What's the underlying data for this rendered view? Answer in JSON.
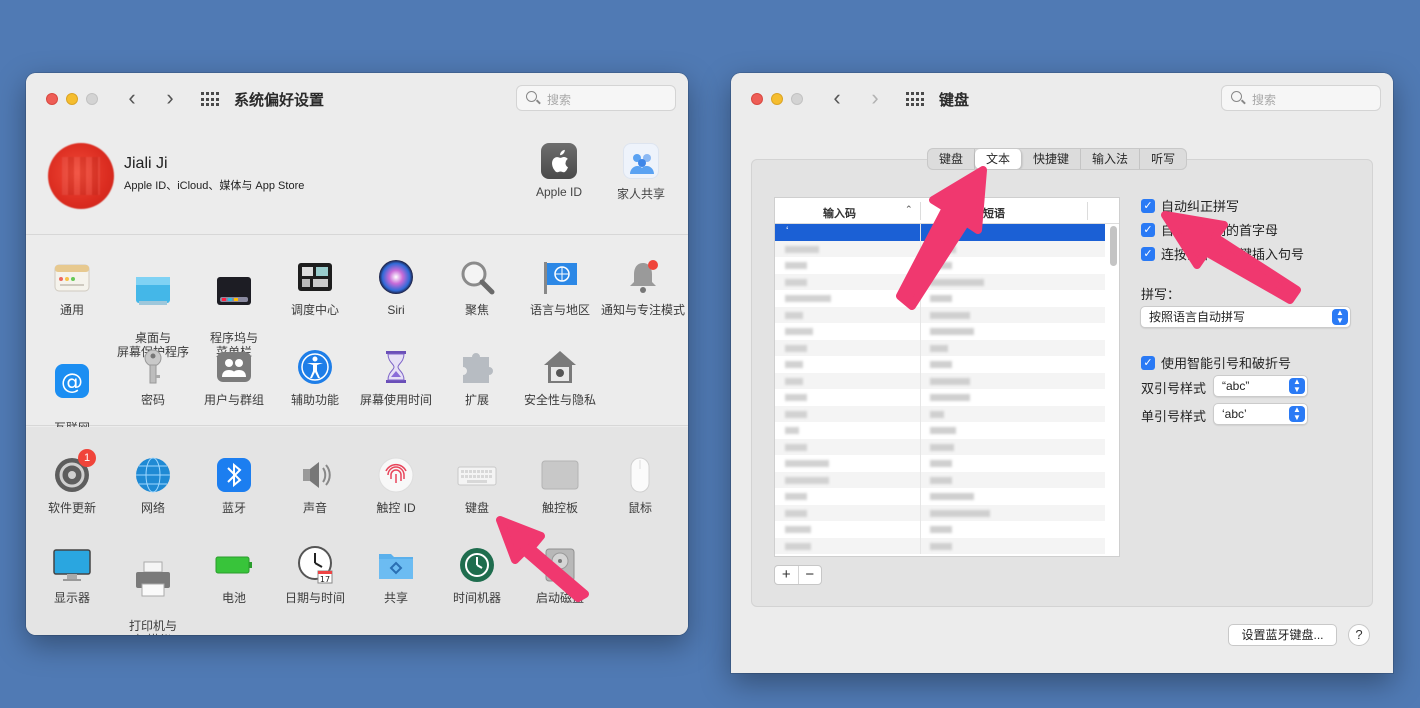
{
  "left_window": {
    "title": "系统偏好设置",
    "search_placeholder": "搜索",
    "profile": {
      "name": "Jiali Ji",
      "subtitle": "Apple ID、iCloud、媒体与 App Store",
      "apple_id_label": "Apple ID",
      "family_label": "家人共享"
    },
    "group2": [
      {
        "label": "通用",
        "icon": "general-icon"
      },
      {
        "label": "桌面与\n屏幕保护程序",
        "icon": "desktop-icon"
      },
      {
        "label": "程序坞与\n菜单栏",
        "icon": "dock-icon"
      },
      {
        "label": "调度中心",
        "icon": "mission-control-icon"
      },
      {
        "label": "Siri",
        "icon": "siri-icon"
      },
      {
        "label": "聚焦",
        "icon": "spotlight-icon"
      },
      {
        "label": "语言与地区",
        "icon": "language-icon"
      },
      {
        "label": "通知与专注模式",
        "icon": "notifications-icon"
      },
      {
        "label": "互联网\n帐户",
        "icon": "internet-accounts-icon"
      },
      {
        "label": "密码",
        "icon": "passwords-icon"
      },
      {
        "label": "用户与群组",
        "icon": "users-icon"
      },
      {
        "label": "辅助功能",
        "icon": "accessibility-icon"
      },
      {
        "label": "屏幕使用时间",
        "icon": "screen-time-icon"
      },
      {
        "label": "扩展",
        "icon": "extensions-icon"
      },
      {
        "label": "安全性与隐私",
        "icon": "security-icon"
      }
    ],
    "group3": [
      {
        "label": "软件更新",
        "icon": "software-update-icon",
        "badge": "1"
      },
      {
        "label": "网络",
        "icon": "network-icon"
      },
      {
        "label": "蓝牙",
        "icon": "bluetooth-icon"
      },
      {
        "label": "声音",
        "icon": "sound-icon"
      },
      {
        "label": "触控 ID",
        "icon": "touch-id-icon"
      },
      {
        "label": "键盘",
        "icon": "keyboard-icon"
      },
      {
        "label": "触控板",
        "icon": "trackpad-icon"
      },
      {
        "label": "鼠标",
        "icon": "mouse-icon"
      },
      {
        "label": "显示器",
        "icon": "display-icon"
      },
      {
        "label": "打印机与\n扫描仪",
        "icon": "printer-icon"
      },
      {
        "label": "电池",
        "icon": "battery-icon"
      },
      {
        "label": "日期与时间",
        "icon": "clock-icon"
      },
      {
        "label": "共享",
        "icon": "sharing-icon"
      },
      {
        "label": "时间机器",
        "icon": "time-machine-icon"
      },
      {
        "label": "启动磁盘",
        "icon": "startup-disk-icon"
      }
    ]
  },
  "right_window": {
    "title": "键盘",
    "search_placeholder": "搜索",
    "tabs": [
      "键盘",
      "文本",
      "快捷键",
      "输入法",
      "听写"
    ],
    "selected_tab": "文本",
    "table": {
      "col1": "输入码",
      "col2": "短语",
      "selected_row": {
        "col1": "‘",
        "col2": "「」"
      }
    },
    "options": {
      "autocorrect": "自动纠正拼写",
      "autocapitalize": "自动大写词的首字母",
      "double_space_period": "连按两下空格键插入句号",
      "spelling_label": "拼写：",
      "spelling_value": "按照语言自动拼写",
      "smart_quotes": "使用智能引号和破折号",
      "double_quote_label": "双引号样式",
      "double_quote_value": "“abc”",
      "single_quote_label": "单引号样式",
      "single_quote_value": "‘abc’"
    },
    "bluetooth_keyboard_button": "设置蓝牙键盘...",
    "help": "?"
  },
  "colors": {
    "accent": "#2a7af5",
    "arrow": "#f0386f",
    "background": "#507ab4"
  }
}
